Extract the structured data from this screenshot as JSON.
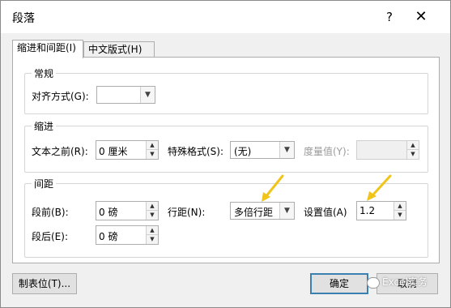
{
  "window": {
    "title": "段落",
    "help_label": "?",
    "close_label": "✕"
  },
  "tabs": [
    {
      "label": "缩进和间距(I)",
      "active": true
    },
    {
      "label": "中文版式(H)",
      "active": false
    }
  ],
  "general": {
    "title": "常规",
    "alignment": {
      "label": "对齐方式(G):",
      "value": ""
    }
  },
  "indent": {
    "title": "缩进",
    "before_text": {
      "label": "文本之前(R):",
      "value": "0 厘米"
    },
    "special": {
      "label": "特殊格式(S):",
      "value": "(无)"
    },
    "amount": {
      "label": "度量值(Y):",
      "value": ""
    }
  },
  "spacing": {
    "title": "间距",
    "before": {
      "label": "段前(B):",
      "value": "0 磅"
    },
    "after": {
      "label": "段后(E):",
      "value": "0 磅"
    },
    "line_spacing": {
      "label": "行距(N):",
      "value": "多倍行距"
    },
    "set_value": {
      "label": "设置值(A)",
      "value": "1.2"
    }
  },
  "footer": {
    "tabs_button": "制表位(T)...",
    "ok_button": "确定",
    "cancel_button": "取消"
  },
  "watermark": {
    "text": "Excel实务"
  },
  "colors": {
    "annotation_arrow": "#f0c419",
    "default_button_border": "#3c7fb1"
  }
}
